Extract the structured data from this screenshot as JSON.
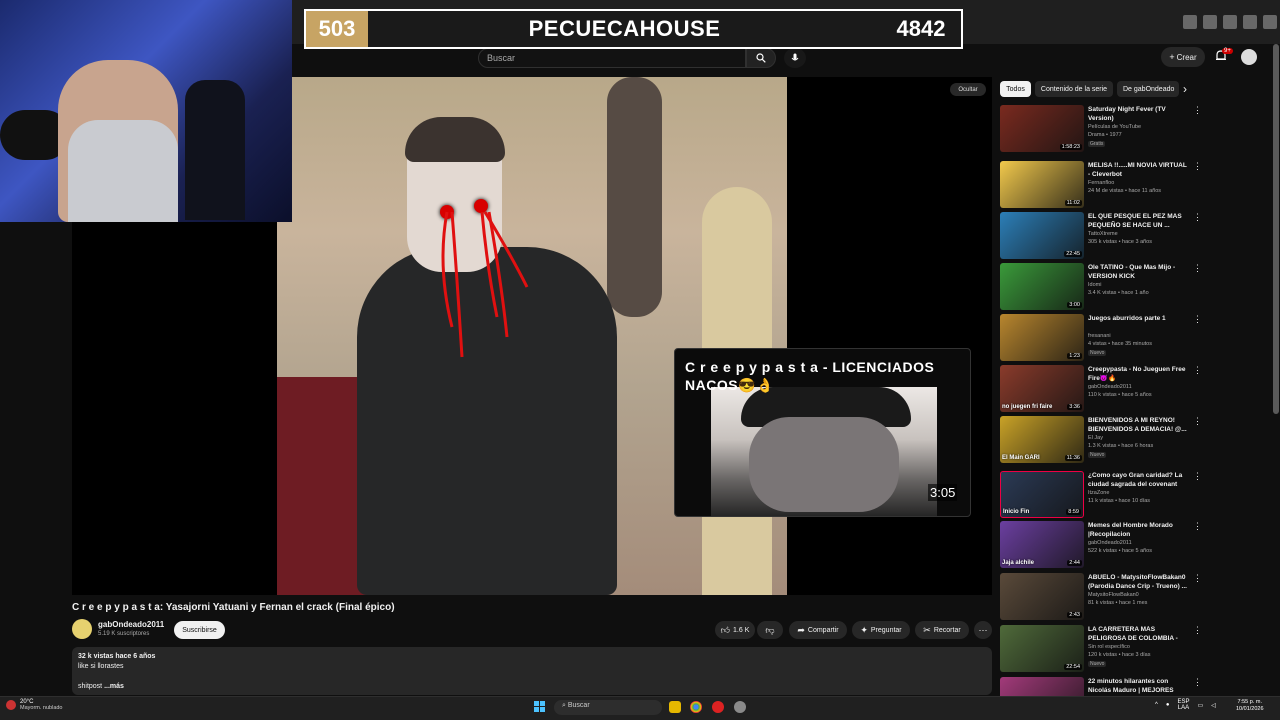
{
  "scoreboard": {
    "left": "503",
    "title": "PECUECAHOUSE",
    "right": "4842"
  },
  "header": {
    "search_placeholder": "Buscar",
    "create_label": "Crear",
    "notif_count": "9+"
  },
  "player": {
    "hide_label": "Ocultar",
    "overlay_title": "C r e e p y p a s t a - LICENCIADOS NACOS😎👌",
    "overlay_duration": "3:05"
  },
  "video": {
    "title": "C r e e p y p a s t a: Yasajorni Yatuani y Fernan el crack (Final épico)",
    "channel": "gabOndeado2011",
    "subscribers": "5.19 K suscriptores",
    "subscribe_label": "Suscribirse",
    "likes": "1.6 K",
    "share_label": "Compartir",
    "ask_label": "Preguntar",
    "clip_label": "Recortar",
    "views_line": "32 k vistas  hace 6 años",
    "desc_line1": "like si llorastes",
    "desc_line2": "shitpost",
    "more_label": "...más"
  },
  "chips": [
    "Todos",
    "Contenido de la serie",
    "De gabOndeado"
  ],
  "recommendations": [
    {
      "title": "Saturday Night Fever (TV Version)",
      "channel": "Películas de YouTube",
      "meta": "Drama • 1977",
      "badge": "Gratis",
      "duration": "1:58:23",
      "thumb_color": "#7a2a1f",
      "thumb_text": ""
    },
    {
      "title": "MELISA !!.....MI NOVIA VIRTUAL - Cleverbot",
      "channel": "Fernanfloo",
      "meta": "24 M de vistas • hace 11 años",
      "badge": "",
      "duration": "11:02",
      "thumb_color": "#f2c94c",
      "thumb_text": ""
    },
    {
      "title": "EL QUE PESQUE EL PEZ MAS PEQUEÑO SE HACE UN ...",
      "channel": "TattoXtreme",
      "meta": "305 k vistas • hace 3 años",
      "badge": "",
      "duration": "22:45",
      "thumb_color": "#2c7fb8",
      "thumb_text": ""
    },
    {
      "title": "Ole TATIÑO - Que Mas Mijo - VERSION KICK",
      "channel": "Idomi",
      "meta": "3.4 K vistas • hace 1 año",
      "badge": "",
      "duration": "3:00",
      "thumb_color": "#3a9a3a",
      "thumb_text": ""
    },
    {
      "title": "Juegos aburridos parte 1",
      "channel": "fresanani",
      "meta": "4 vistas • hace 35 minutos",
      "badge": "Nuevo",
      "duration": "1:23",
      "thumb_color": "#b8862e",
      "thumb_text": ""
    },
    {
      "title": "Creepypasta - No Jueguen Free Fire😈🔥",
      "channel": "gabOndeado2011",
      "meta": "110 k vistas • hace 5 años",
      "badge": "",
      "duration": "3:36",
      "thumb_color": "#8a3b2b",
      "thumb_text": "no juegen fri faire"
    },
    {
      "title": "BIENVENIDOS A MI REYNO! BIENVENIDOS A DEMACIA! @...",
      "channel": "El Jay",
      "meta": "1.3 K vistas • hace 6 horas",
      "badge": "Nuevo",
      "duration": "11:36",
      "thumb_color": "#c9a227",
      "thumb_text": "El Main GARI"
    },
    {
      "title": "¿Como cayo Gran caridad?  La ciudad sagrada del covenant",
      "channel": "ItzaZone",
      "meta": "11 k vistas • hace 10 días",
      "badge": "",
      "duration": "8:59",
      "thumb_color": "#2b3a55",
      "thumb_text": "Inicio     Fin"
    },
    {
      "title": "Memes del Hombre Morado |Recopilacion",
      "channel": "gabOndeado2011",
      "meta": "522 k vistas • hace 5 años",
      "badge": "",
      "duration": "2:44",
      "thumb_color": "#6b3fa0",
      "thumb_text": "Jaja alchile"
    },
    {
      "title": "ABUELO - MatysitoFlowBakan0 (Parodia Dance Crip - Trueno) ...",
      "channel": "MatysitoFlowBakan0",
      "meta": "81 k vistas • hace 1 mes",
      "badge": "",
      "duration": "2:43",
      "thumb_color": "#5a4a3a",
      "thumb_text": ""
    },
    {
      "title": "LA CARRETERA MÁS PELIGROSA DE COLOMBIA - E...",
      "channel": "Sin rol específico",
      "meta": "120 k vistas • hace 3 días",
      "badge": "Nuevo",
      "duration": "22:54",
      "thumb_color": "#4f6a3a",
      "thumb_text": ""
    },
    {
      "title": "22 minutos hilarantes con Nicolás Maduro | MEJORES",
      "channel": "",
      "meta": "",
      "badge": "",
      "duration": "",
      "thumb_color": "#a23a7a",
      "thumb_text": "MEJORES MOMENTOS"
    }
  ],
  "taskbar": {
    "temperature": "20°C",
    "weather": "Mayorm. nublado",
    "search_label": "Buscar",
    "lang": "ESP",
    "lang2": "LAA",
    "time": "7:55 p. m.",
    "date": "10/01/2026"
  },
  "colors": {
    "accent": "#f1f1f1",
    "background": "#0f0f0f",
    "badge_red": "#cc0000"
  }
}
